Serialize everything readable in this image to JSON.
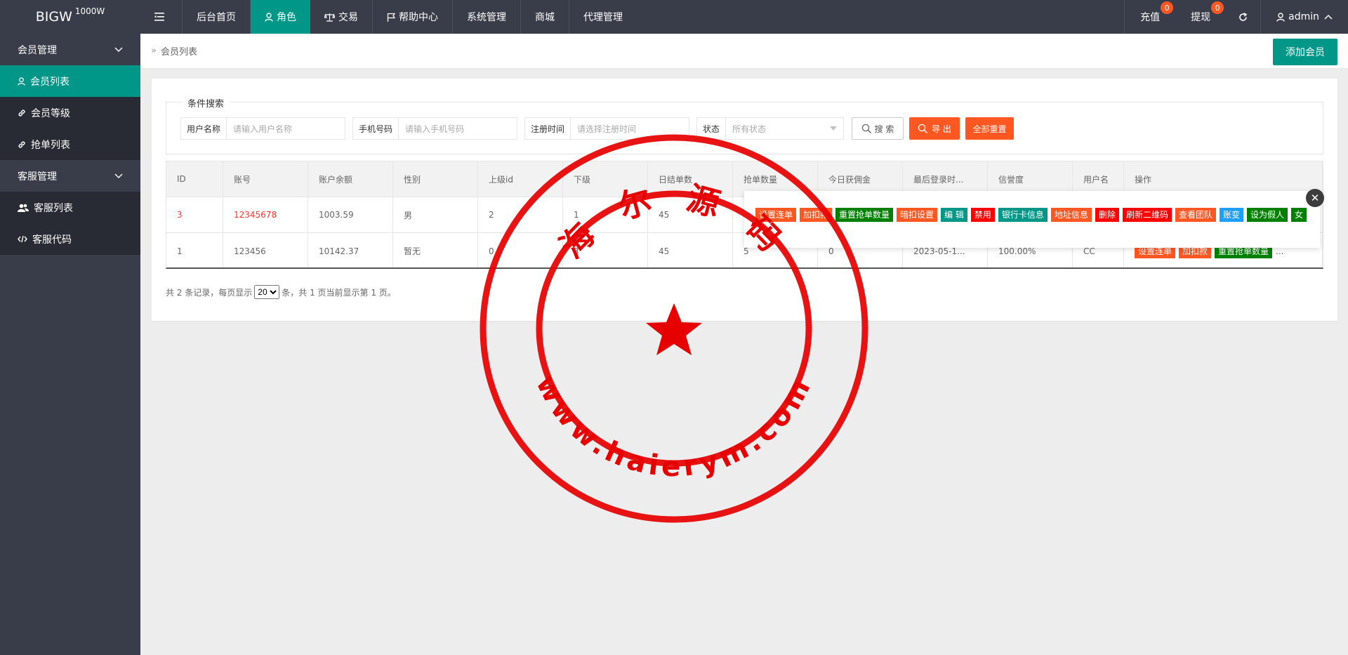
{
  "logo": {
    "text": "BIGW",
    "sup": "1000W"
  },
  "topnav": {
    "items": [
      {
        "label": ""
      },
      {
        "label": "后台首页"
      },
      {
        "label": "角色"
      },
      {
        "label": "交易"
      },
      {
        "label": "帮助中心"
      },
      {
        "label": "系统管理"
      },
      {
        "label": "商城"
      },
      {
        "label": "代理管理"
      }
    ],
    "recharge": {
      "label": "充值",
      "badge": "0"
    },
    "withdraw": {
      "label": "提现",
      "badge": "0"
    },
    "user": "admin"
  },
  "sidebar": {
    "groups": [
      {
        "label": "会员管理",
        "items": [
          {
            "label": "会员列表"
          },
          {
            "label": "会员等级"
          },
          {
            "label": "抢单列表"
          }
        ]
      },
      {
        "label": "客服管理",
        "items": [
          {
            "label": "客服列表"
          },
          {
            "label": "客服代码"
          }
        ]
      }
    ]
  },
  "breadcrumb": {
    "icon": "»",
    "text": "会员列表"
  },
  "add_button": "添加会员",
  "search": {
    "legend": "条件搜索",
    "username": {
      "label": "用户名称",
      "placeholder": "请输入用户名称"
    },
    "phone": {
      "label": "手机号码",
      "placeholder": "请输入手机号码"
    },
    "regtime": {
      "label": "注册时间",
      "placeholder": "请选择注册时间"
    },
    "status": {
      "label": "状态",
      "value": "所有状态"
    },
    "search_btn": "搜 索",
    "export_btn": "导 出",
    "reset_btn": "全部重置"
  },
  "table": {
    "headers": [
      "ID",
      "账号",
      "账户余额",
      "性别",
      "上级id",
      "下级",
      "日结单数",
      "抢单数量",
      "今日获佣金",
      "最后登录时...",
      "信誉度",
      "用户名",
      "操作"
    ],
    "rows": [
      {
        "cells": [
          "3",
          "12345678",
          "1003.59",
          "男",
          "2",
          "1",
          "45",
          "",
          "",
          "",
          "",
          ""
        ]
      },
      {
        "cells": [
          "1",
          "123456",
          "10142.37",
          "暂无",
          "0",
          "3",
          "45",
          "5",
          "0",
          "2023-05-1...",
          "100.00%",
          "CC"
        ],
        "ops": [
          "设置连单",
          "加扣款",
          "重置抢单数量"
        ],
        "more": "..."
      }
    ]
  },
  "pager": {
    "prefix": "共 2 条记录，每页显示",
    "per_page": "20",
    "suffix": "条，共 1 页当前显示第 1 页。"
  },
  "popup": {
    "actions": [
      {
        "label": "设置连单",
        "color": "#ff5722"
      },
      {
        "label": "加扣款",
        "color": "#ff5722"
      },
      {
        "label": "重置抢单数量",
        "color": "#008000"
      },
      {
        "label": "暗扣设置",
        "color": "#ff5722"
      },
      {
        "label": "编 辑",
        "color": "#009688"
      },
      {
        "label": "禁用",
        "color": "#ff0000"
      },
      {
        "label": "银行卡信息",
        "color": "#009688"
      },
      {
        "label": "地址信息",
        "color": "#ff5722"
      },
      {
        "label": "删除",
        "color": "#ff0000"
      },
      {
        "label": "刷新二维码",
        "color": "#ff0000"
      },
      {
        "label": "查看团队",
        "color": "#ff5722"
      },
      {
        "label": "账变",
        "color": "#1e9fff"
      },
      {
        "label": "设为假人",
        "color": "#008000"
      },
      {
        "label": "女",
        "color": "#008000"
      }
    ]
  },
  "watermark": {
    "top_text": "海 尔 源 码",
    "bottom_text": "www.haierym.com"
  }
}
